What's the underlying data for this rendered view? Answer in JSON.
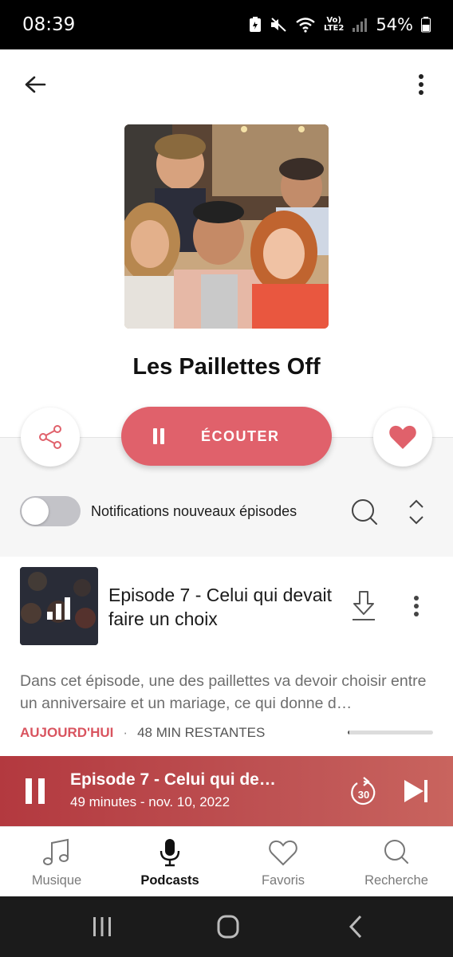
{
  "status_bar": {
    "time": "08:39",
    "volte": "Vo)\nLTE2",
    "battery": "54%"
  },
  "show": {
    "title": "Les Paillettes Off",
    "listen_label": "ÉCOUTER"
  },
  "notifications": {
    "label": "Notifications nouveaux épisodes",
    "enabled": false
  },
  "episode": {
    "title": "Episode 7 - Celui qui devait faire un choix",
    "description": "Dans cet épisode, une des paillettes va devoir choisir entre un anniversaire et un mariage, ce qui donne d…",
    "date": "AUJOURD'HUI",
    "separator": "·",
    "remaining": "48 MIN RESTANTES",
    "progress": 0.02
  },
  "mini_player": {
    "title": "Episode 7 - Celui qui de…",
    "subtitle": "49 minutes - nov. 10, 2022",
    "skip_label": "30"
  },
  "bottom_nav": [
    {
      "label": "Musique",
      "icon": "music-note-icon",
      "active": false
    },
    {
      "label": "Podcasts",
      "icon": "microphone-icon",
      "active": true
    },
    {
      "label": "Favoris",
      "icon": "heart-outline-icon",
      "active": false
    },
    {
      "label": "Recherche",
      "icon": "search-icon",
      "active": false
    }
  ],
  "colors": {
    "accent": "#e0616b",
    "player": "#b3393f",
    "date": "#d9545f"
  }
}
